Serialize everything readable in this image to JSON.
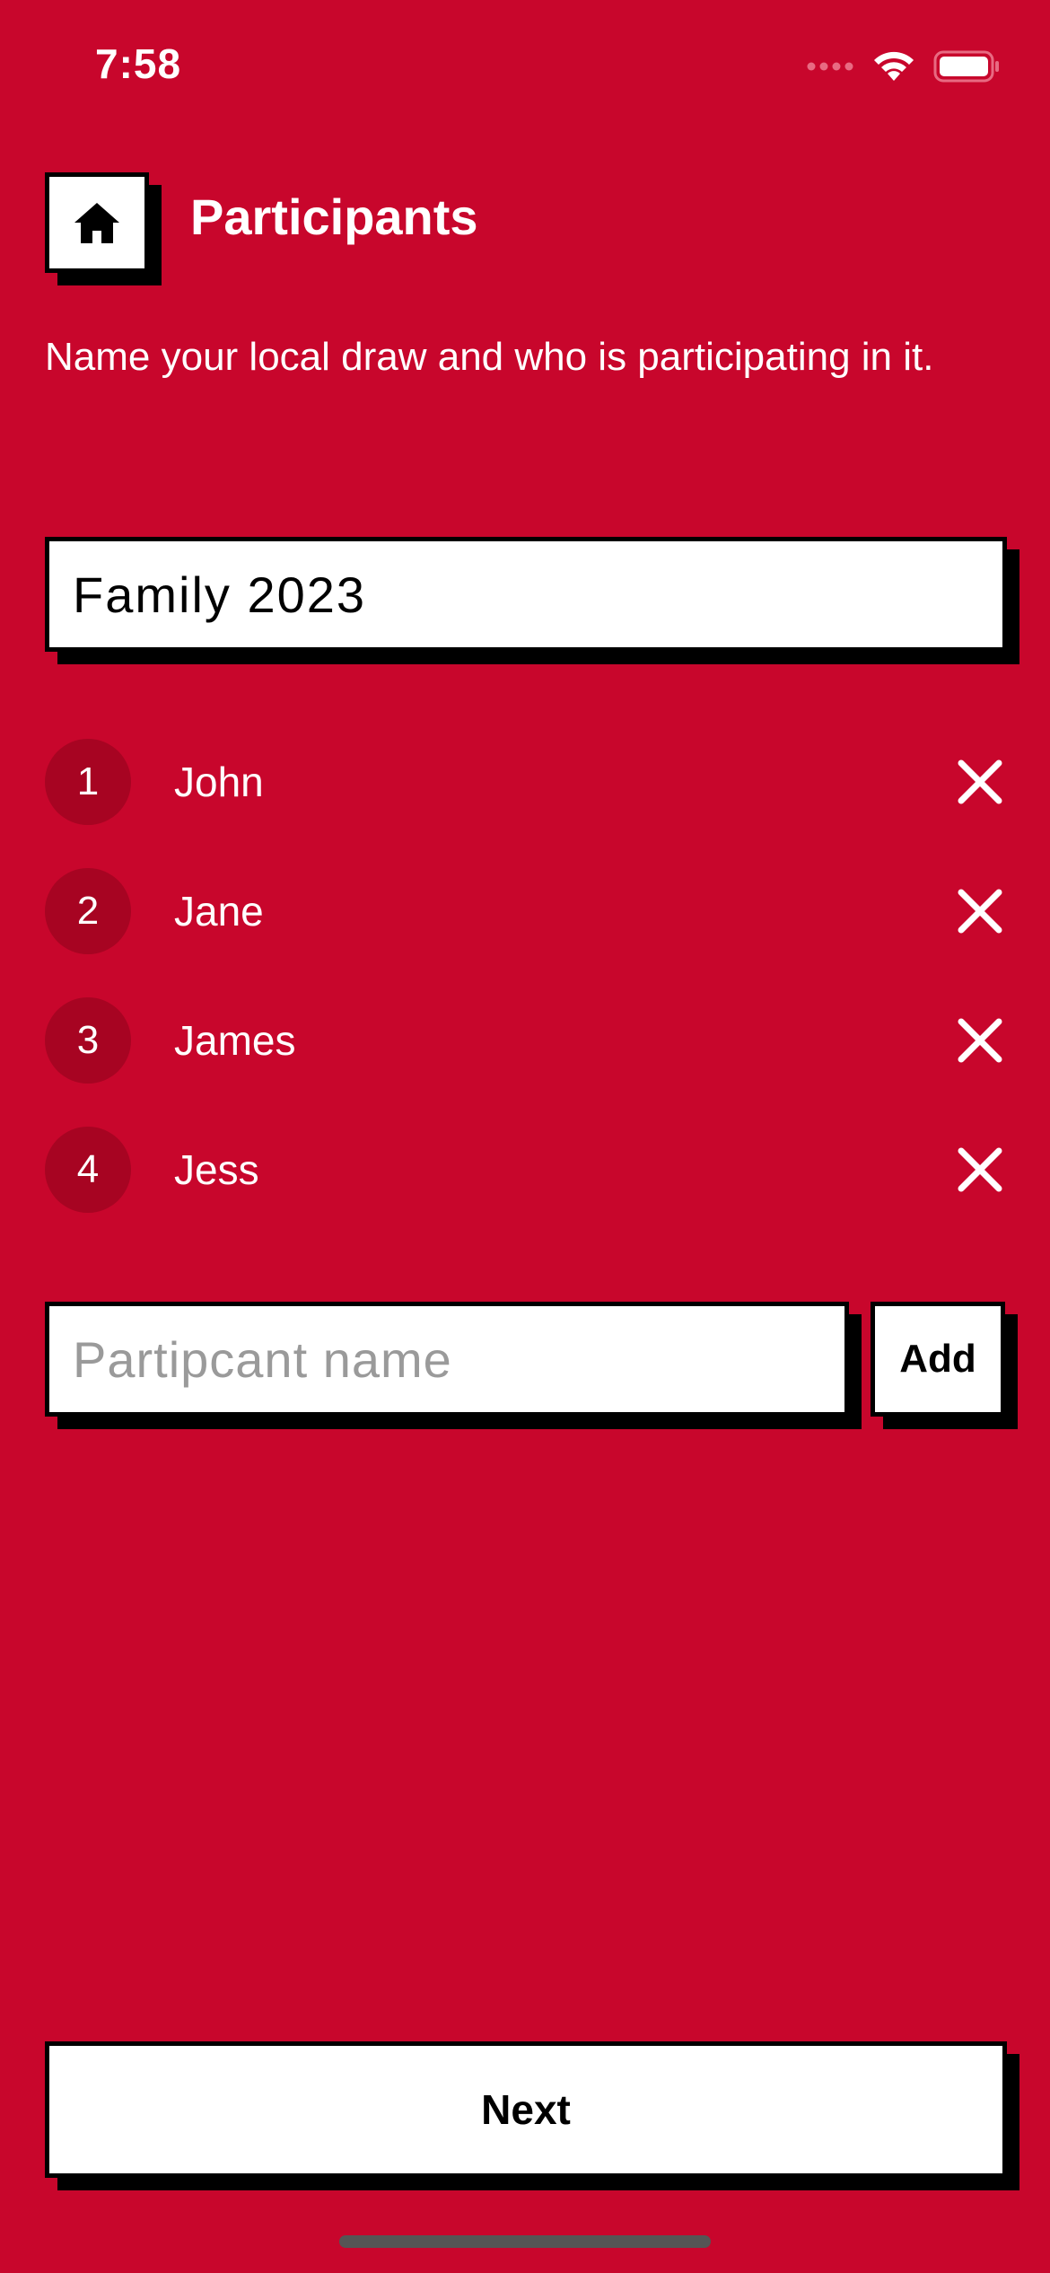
{
  "status_bar": {
    "time": "7:58"
  },
  "header": {
    "title": "Participants",
    "home_icon": "home-icon"
  },
  "subtitle": "Name your local draw and who is participating in it.",
  "draw_name": {
    "value": "Family 2023"
  },
  "participants": [
    {
      "number": "1",
      "name": "John"
    },
    {
      "number": "2",
      "name": "Jane"
    },
    {
      "number": "3",
      "name": "James"
    },
    {
      "number": "4",
      "name": "Jess"
    }
  ],
  "add_participant": {
    "placeholder": "Partipcant name",
    "button_label": "Add"
  },
  "next_label": "Next",
  "colors": {
    "background": "#C8062C",
    "number_badge": "#A70422",
    "text": "#FFFFFF",
    "box": "#FFFFFF",
    "shadow": "#000000"
  }
}
